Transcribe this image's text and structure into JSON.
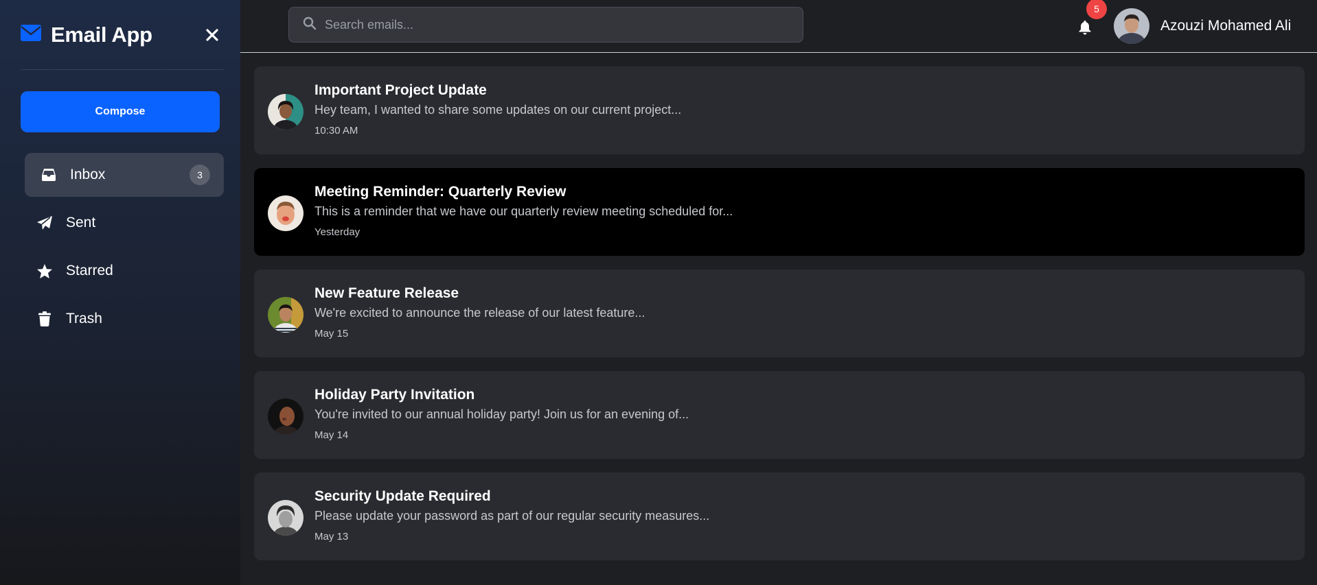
{
  "app": {
    "title": "Email App",
    "accent_color": "#0b63ff",
    "icon": "envelope-icon"
  },
  "sidebar": {
    "compose_label": "Compose",
    "items": [
      {
        "label": "Inbox",
        "icon": "inbox-icon",
        "count": "3",
        "active": true
      },
      {
        "label": "Sent",
        "icon": "paper-plane-icon",
        "active": false
      },
      {
        "label": "Starred",
        "icon": "star-icon",
        "active": false
      },
      {
        "label": "Trash",
        "icon": "trash-icon",
        "active": false
      }
    ]
  },
  "header": {
    "search_placeholder": "Search emails...",
    "notification_count": "5",
    "user_name": "Azouzi Mohamed Ali"
  },
  "emails": [
    {
      "subject": "Important Project Update",
      "preview": "Hey team, I wanted to share some updates on our current project...",
      "time": "10:30 AM",
      "selected": false
    },
    {
      "subject": "Meeting Reminder: Quarterly Review",
      "preview": "This is a reminder that we have our quarterly review meeting scheduled for...",
      "time": "Yesterday",
      "selected": true
    },
    {
      "subject": "New Feature Release",
      "preview": "We're excited to announce the release of our latest feature...",
      "time": "May 15",
      "selected": false
    },
    {
      "subject": "Holiday Party Invitation",
      "preview": "You're invited to our annual holiday party! Join us for an evening of...",
      "time": "May 14",
      "selected": false
    },
    {
      "subject": "Security Update Required",
      "preview": "Please update your password as part of our regular security measures...",
      "time": "May 13",
      "selected": false
    }
  ]
}
